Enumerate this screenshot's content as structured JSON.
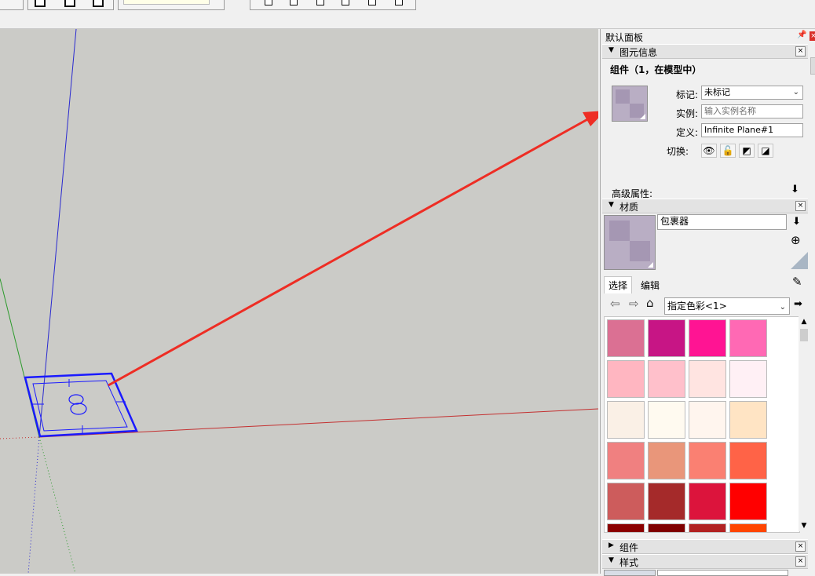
{
  "panel": {
    "title": "默认面板",
    "entity_info": {
      "header": "图元信息",
      "heading": "组件（1，在模型中）",
      "tag_label": "标记:",
      "tag_value": "未标记",
      "instance_label": "实例:",
      "instance_placeholder": "输入实例名称",
      "definition_label": "定义:",
      "definition_value": "Infinite Plane#1",
      "toggle_label": "切换:",
      "advanced_label": "高级属性:"
    },
    "materials": {
      "header": "材质",
      "material_name": "包裹器",
      "tabs": [
        "选择",
        "编辑"
      ],
      "library": "指定色彩<1>",
      "swatches": [
        [
          "#db7093",
          "#c71585",
          "#ff1493",
          "#ff69b4"
        ],
        [
          "#ffb6c1",
          "#ffc0cb",
          "#ffe4e1",
          "#fff0f5"
        ],
        [
          "#faf0e6",
          "#fffaf0",
          "#fff5ee",
          "#ffe4c4"
        ],
        [
          "#f08080",
          "#e9967a",
          "#fa8072",
          "#ff6347"
        ],
        [
          "#cd5c5c",
          "#a52a2a",
          "#dc143c",
          "#ff0000"
        ],
        [
          "#8b0000",
          "#800000",
          "#b22222",
          "#ff4500"
        ]
      ]
    },
    "components": {
      "header": "组件"
    },
    "styles": {
      "header": "样式"
    },
    "close_symbol": "×"
  },
  "icons": {
    "pin": "pin-icon",
    "eye": "eye-icon",
    "lock": "lock-icon",
    "shadow_cast": "cast-shadow-icon",
    "shadow_receive": "receive-shadow-icon",
    "back": "back-arrow-icon",
    "forward": "forward-arrow-icon",
    "home": "home-icon",
    "eyedropper": "eyedropper-icon"
  },
  "colors": {
    "viewport_bg": "#cbcbc7",
    "selection_blue": "#1a1aff",
    "annotation_arrow": "#ee2d24",
    "axis_red": "#c43030",
    "axis_green": "#2b9a2b",
    "axis_blue": "#2a2ad0",
    "material_gray": "#b9aec4"
  }
}
